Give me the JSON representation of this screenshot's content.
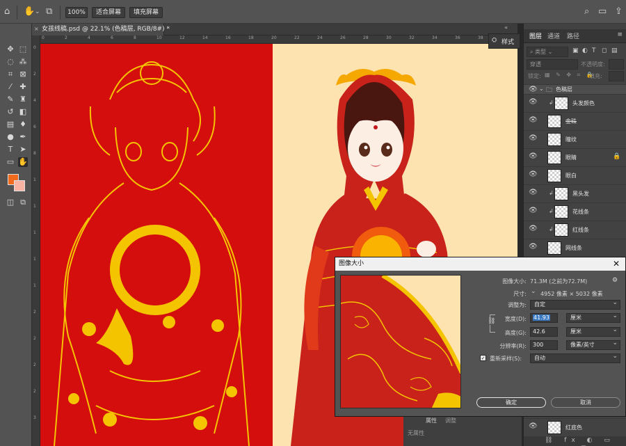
{
  "options_bar": {
    "zoom_100": "100%",
    "fit_screen": "适合屏幕",
    "fill_screen": "填充屏幕"
  },
  "document": {
    "tab_title": "女孩线稿.psd @ 22.1% (色稿层, RGB/8#) *",
    "ruler_top_ticks": [
      "0",
      "2",
      "4",
      "6",
      "8",
      "10",
      "12",
      "14",
      "16",
      "18",
      "20",
      "22",
      "24",
      "26",
      "28",
      "30",
      "32",
      "34",
      "36",
      "38",
      "40"
    ],
    "ruler_left_ticks": [
      "0",
      "2",
      "4",
      "6",
      "8",
      "1",
      "1",
      "1",
      "1",
      "1",
      "2",
      "2",
      "2",
      "2",
      "3"
    ]
  },
  "tools": {
    "foreground_color": "#f26a1b",
    "background_color": "#f9b3a3"
  },
  "style_panel": {
    "label": "样式"
  },
  "layers_panel": {
    "tabs": [
      "图层",
      "通道",
      "路径"
    ],
    "kind_filter": "类型",
    "blend_mode": "穿透",
    "opacity_label": "不透明度:",
    "lock_label": "锁定:",
    "fill_label": "填充:",
    "group_name": "色稿层",
    "layers": [
      "头发颜色",
      "金珠",
      "瞳纹",
      "眼睛",
      "眼白",
      "黑头发",
      "花线条",
      "红线条",
      "网线条"
    ],
    "bottom_layer": "红底色"
  },
  "dialog": {
    "title": "图像大小",
    "image_size_label": "图像大小:",
    "image_size_value": "71.3M (之前为72.7M)",
    "dimensions_label": "尺寸:",
    "dimensions_value": "4952 像素 × 5032 像素",
    "fit_to_label": "调整为:",
    "fit_to_value": "自定",
    "width_label": "宽度(D):",
    "width_value": "41.93",
    "width_unit": "厘米",
    "height_label": "高度(G):",
    "height_value": "42.6",
    "height_unit": "厘米",
    "resolution_label": "分辨率(R):",
    "resolution_value": "300",
    "resolution_unit": "像素/英寸",
    "resample_label": "重新采样(S):",
    "resample_value": "自动",
    "ok": "确定",
    "cancel": "取消"
  },
  "under_dialog_tabs": [
    "属性",
    "调整"
  ],
  "properties_label": "无属性"
}
